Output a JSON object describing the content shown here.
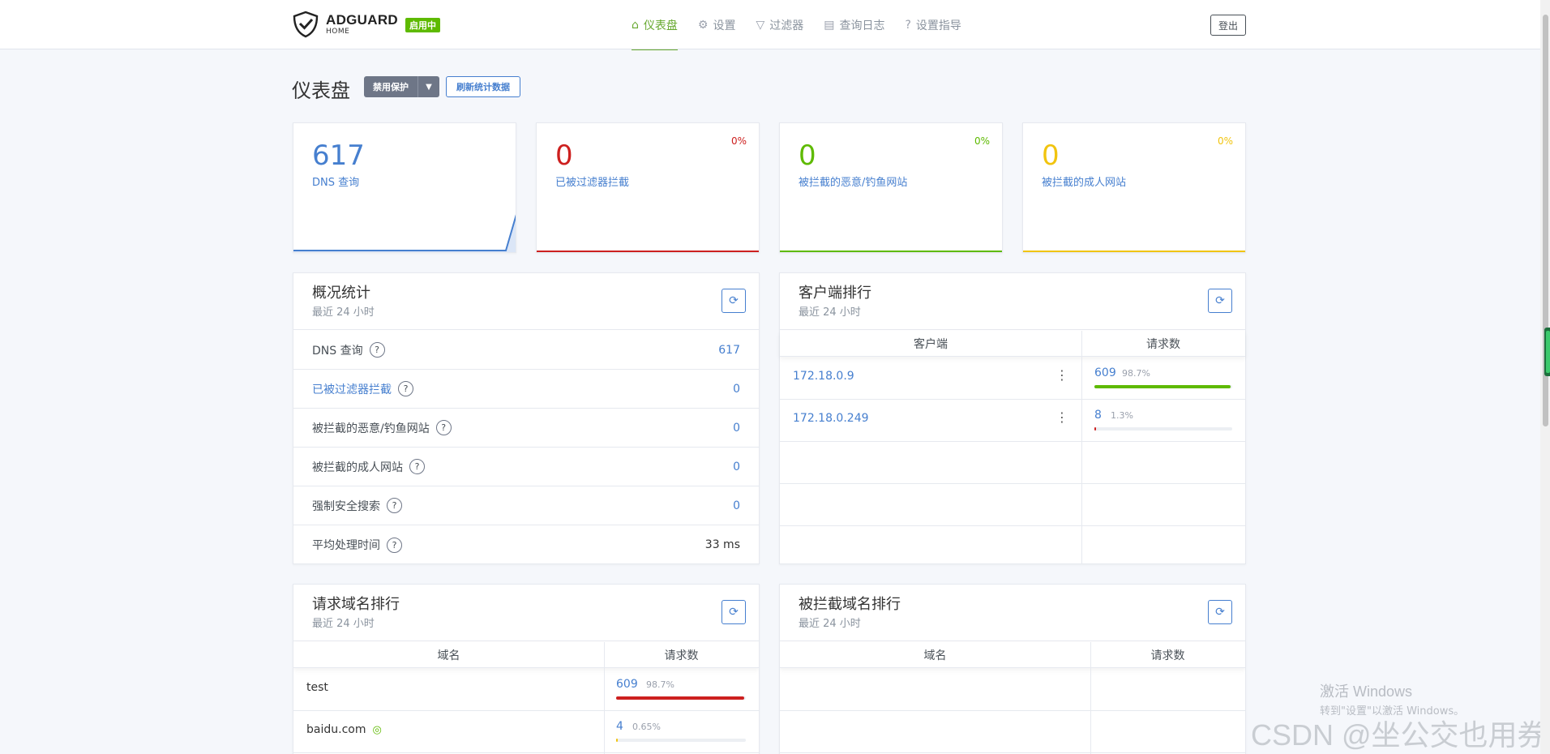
{
  "app": {
    "logo_main": "ADGUARD",
    "logo_sub": "HOME",
    "status_badge": "启用中"
  },
  "nav": {
    "items": [
      {
        "label": "仪表盘",
        "icon": "home-icon",
        "active": true
      },
      {
        "label": "设置",
        "icon": "gear-icon",
        "active": false
      },
      {
        "label": "过滤器",
        "icon": "filter-icon",
        "active": false
      },
      {
        "label": "查询日志",
        "icon": "document-icon",
        "active": false
      },
      {
        "label": "设置指导",
        "icon": "help-icon",
        "active": false
      }
    ],
    "logout": "登出"
  },
  "page": {
    "title": "仪表盘",
    "disable_protection": "禁用保护",
    "refresh_stats": "刷新统计数据"
  },
  "stats": [
    {
      "value": "617",
      "label": "DNS 查询",
      "percent": "",
      "color": "#467fcf"
    },
    {
      "value": "0",
      "label": "已被过滤器拦截",
      "percent": "0%",
      "color": "#cd201f"
    },
    {
      "value": "0",
      "label": "被拦截的恶意/钓鱼网站",
      "percent": "0%",
      "color": "#5eba00"
    },
    {
      "value": "0",
      "label": "被拦截的成人网站",
      "percent": "0%",
      "color": "#f1c40f"
    }
  ],
  "overview": {
    "title": "概况统计",
    "subtitle": "最近 24 小时",
    "rows": [
      {
        "label": "DNS 查询",
        "value": "617"
      },
      {
        "label": "已被过滤器拦截",
        "value": "0"
      },
      {
        "label": "被拦截的恶意/钓鱼网站",
        "value": "0"
      },
      {
        "label": "被拦截的成人网站",
        "value": "0"
      },
      {
        "label": "强制安全搜索",
        "value": "0"
      },
      {
        "label": "平均处理时间",
        "value": "33 ms"
      }
    ]
  },
  "clients": {
    "title": "客户端排行",
    "subtitle": "最近 24 小时",
    "col_client": "客户端",
    "col_requests": "请求数",
    "rows": [
      {
        "name": "172.18.0.9",
        "count": "609",
        "percent": "98.7%",
        "fraction": 0.987
      },
      {
        "name": "172.18.0.249",
        "count": "8",
        "percent": "1.3%",
        "fraction": 0.013
      }
    ]
  },
  "domains": {
    "title": "请求域名排行",
    "subtitle": "最近 24 小时",
    "col_domain": "域名",
    "col_requests": "请求数",
    "rows": [
      {
        "name": "test",
        "count": "609",
        "percent": "98.7%",
        "fraction": 0.987
      },
      {
        "name": "baidu.com",
        "count": "4",
        "percent": "0.65%",
        "fraction": 0.0065
      }
    ]
  },
  "blocked": {
    "title": "被拦截域名排行",
    "subtitle": "最近 24 小时",
    "col_domain": "域名",
    "col_requests": "请求数"
  },
  "watermark": {
    "line1": "激活 Windows",
    "line2": "转到\"设置\"以激活 Windows。",
    "csdn": "CSDN @坐公交也用券"
  }
}
